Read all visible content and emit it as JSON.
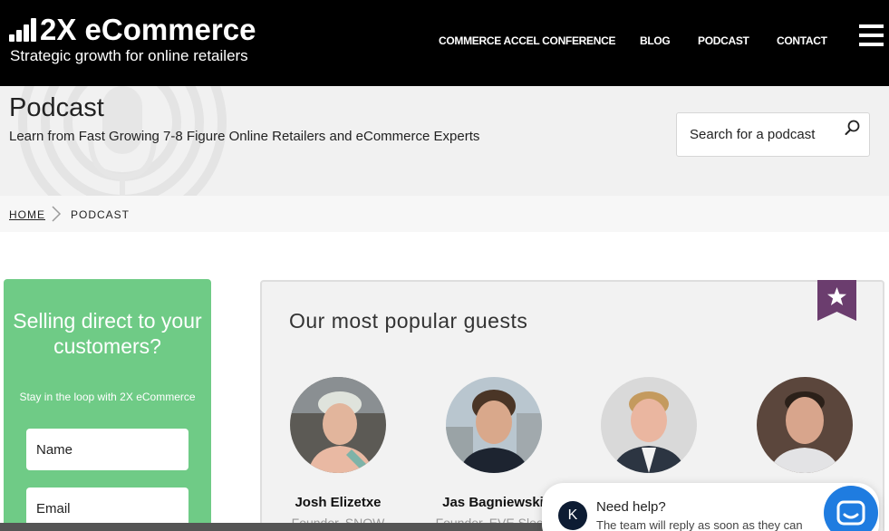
{
  "header": {
    "logo_title": "2X eCommerce",
    "logo_tagline": "Strategic growth for online retailers",
    "nav": [
      {
        "label": "COMMERCE ACCEL CONFERENCE"
      },
      {
        "label": "BLOG"
      },
      {
        "label": "PODCAST"
      },
      {
        "label": "CONTACT"
      }
    ],
    "menu_icon": "hamburger-menu-icon",
    "logo_icon": "bar-chart-icon"
  },
  "hero": {
    "title": "Podcast",
    "subtitle": "Learn from Fast Growing 7-8 Figure Online Retailers and eCommerce Experts",
    "search_placeholder": "Search for a podcast",
    "search_icon": "search-icon",
    "decoration_icon": "microphone-icon"
  },
  "breadcrumb": {
    "home": "HOME",
    "current": "PODCAST",
    "separator_icon": "chevron-right-icon"
  },
  "signup": {
    "title": "Selling direct to your customers?",
    "subtitle": "Stay in the loop with 2X eCommerce",
    "name_placeholder": "Name",
    "email_placeholder": "Email"
  },
  "guests": {
    "title": "Our most popular guests",
    "ribbon_icon": "star-icon",
    "items": [
      {
        "name": "Josh Elizetxe",
        "role": "Founder, SNOW"
      },
      {
        "name": "Jas Bagniewski",
        "role": "Founder, EVE Sleep"
      },
      {
        "name": "",
        "role": ""
      },
      {
        "name": "",
        "role": ""
      }
    ]
  },
  "chat": {
    "avatar_letter": "K",
    "title": "Need help?",
    "text": "The team will reply as soon as they can",
    "launcher_icon": "chat-icon"
  },
  "colors": {
    "header_bg": "#000000",
    "hero_bg": "#f1f1f1",
    "signup_green": "#6fcb86",
    "ribbon_purple": "#6b3d6e",
    "chat_blue": "#1f7ce0"
  }
}
